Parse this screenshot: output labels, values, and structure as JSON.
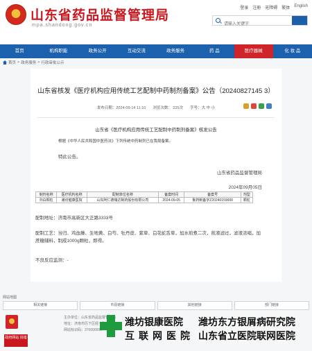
{
  "header": {
    "title": "山东省药品监督管理局",
    "domain": "mpa.shandong.gov.cn",
    "top_links": [
      "登录",
      "注册",
      "无障碍",
      "繁体",
      "English"
    ],
    "search_placeholder": "请输入关键字"
  },
  "nav": {
    "items": [
      "首页",
      "机构职能",
      "政务公开",
      "互动交流",
      "政务服务",
      "药 品",
      "医疗器械",
      "化 妆 品"
    ]
  },
  "breadcrumb": {
    "items": [
      "首页",
      "政务服务",
      "行政审批公示"
    ]
  },
  "article": {
    "title": "山东省核发《医疗机构应用传统工艺配制中药制剂备案》公告（20240827145 3）",
    "publish_label": "发布日期：2024-09-14 11:10",
    "views_label": "浏览次数： 225次",
    "font_label": "字号：大 中 小",
    "doc_heading": "山东省《医疗机构应用传统工艺配制中药制剂备案》核发公告",
    "para1": "根据《中华人民共和国中医药法》下列传统中药制剂已在我局备案。",
    "para2": "特此公告。",
    "signer": "山东省药品监督管理局",
    "date": "2024年09月05日",
    "table": {
      "headers": [
        "制剂名称",
        "医疗机构名称",
        "配制单位名称",
        "备案时间",
        "备案号",
        "剂型"
      ],
      "rows": [
        [
          "归白颗粒",
          "潍坊健康医院",
          "山东阿仁德瑞达制药股份有限公司",
          "2024-09-05",
          "鲁药制备字Z20240159000",
          "颗粒"
        ]
      ]
    },
    "address": "配制地址：济南市高新区大正路3333号",
    "craft": "配制工艺：当归、鸡血藤、生地黄、白芍、牡丹皮、紫草、白花蛇舌草，加水煎煮二次，煎液滤过，滤液浓缩，加蔗糖辅料，制成1000g颗粒，即得。",
    "adr": "不良反应监测：-"
  },
  "footer": {
    "label": "网站地图",
    "links": [
      "相关链接",
      "市县链接",
      "其他链接",
      "部门链接"
    ],
    "text_lines": [
      "主办单位：山东省药品监督管理局",
      "地址：济南市历下区经十路",
      "网站标识码：3700000084"
    ],
    "gov_badge": "党政机关",
    "error_badge": "政府网站 找错"
  },
  "overlay": {
    "line_a": "潍坊银康医院",
    "line_b": "互联网医院",
    "line_c": "潍坊东方银屑病研究院",
    "line_d": "山东省立医院联网医院"
  },
  "colors": {
    "brand_red": "#c8171e",
    "nav_blue": "#1c61ad",
    "active_nav": "#d0242b"
  }
}
